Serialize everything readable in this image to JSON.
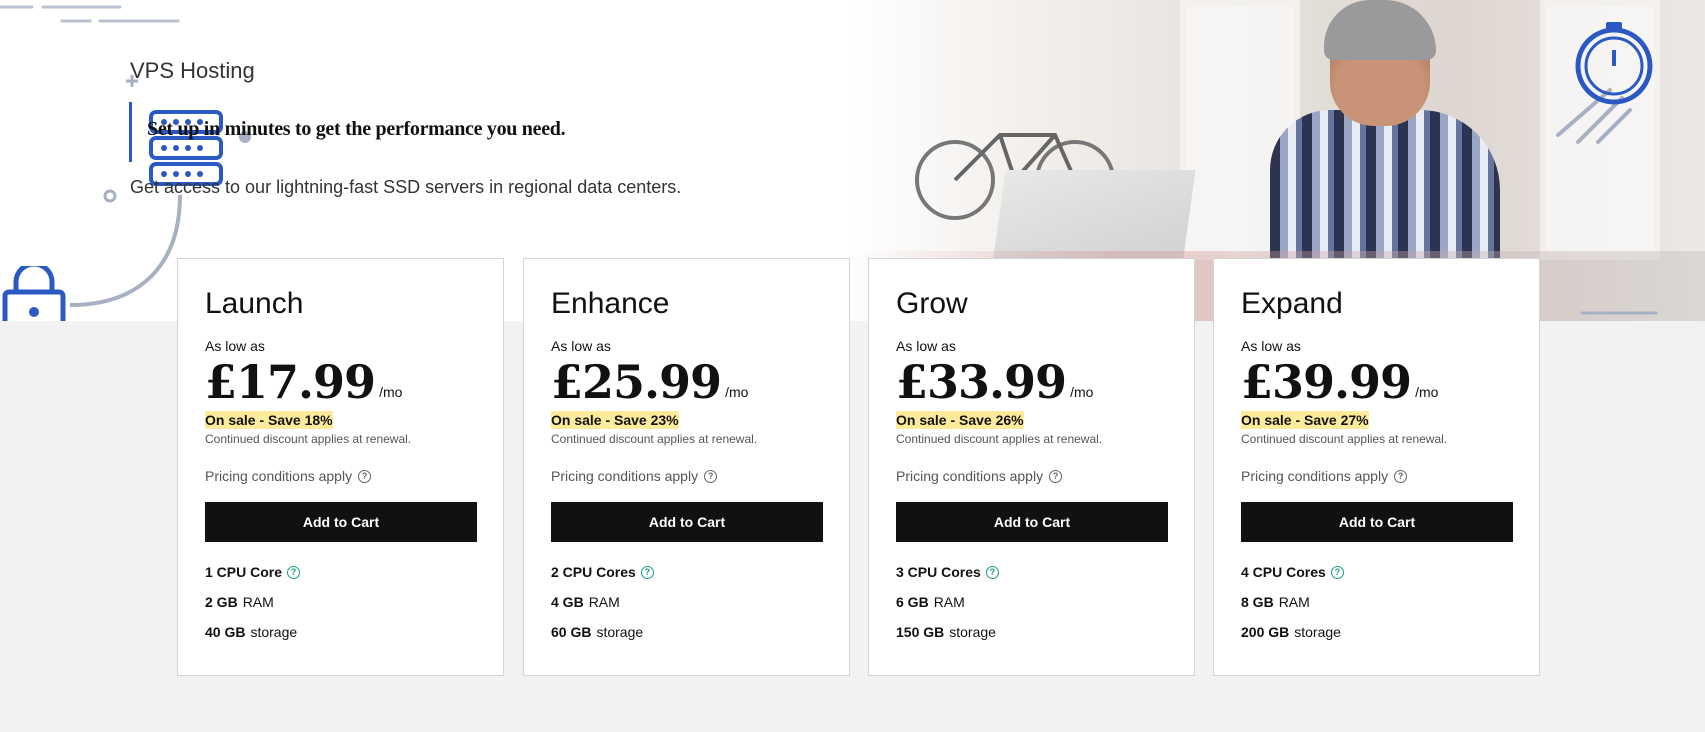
{
  "hero": {
    "title": "VPS Hosting",
    "tagline": "Set up in minutes to get the performance you need.",
    "subtitle": "Get access to our lightning-fast SSD servers in regional data centers.",
    "accent_color": "#2b59c3"
  },
  "plans": [
    {
      "name": "Launch",
      "as_low_as": "As low as",
      "price": "£17.99",
      "per": "/mo",
      "sale": "On sale - Save 18%",
      "renewal": "Continued discount applies at renewal.",
      "conditions": "Pricing conditions apply",
      "cta": "Add to Cart",
      "cpu_value": "1 CPU Core",
      "ram_value": "2 GB",
      "ram_unit": "RAM",
      "storage_value": "40 GB",
      "storage_unit": "storage"
    },
    {
      "name": "Enhance",
      "as_low_as": "As low as",
      "price": "£25.99",
      "per": "/mo",
      "sale": "On sale - Save 23%",
      "renewal": "Continued discount applies at renewal.",
      "conditions": "Pricing conditions apply",
      "cta": "Add to Cart",
      "cpu_value": "2 CPU Cores",
      "ram_value": "4 GB",
      "ram_unit": "RAM",
      "storage_value": "60 GB",
      "storage_unit": "storage"
    },
    {
      "name": "Grow",
      "as_low_as": "As low as",
      "price": "£33.99",
      "per": "/mo",
      "sale": "On sale - Save 26%",
      "renewal": "Continued discount applies at renewal.",
      "conditions": "Pricing conditions apply",
      "cta": "Add to Cart",
      "cpu_value": "3 CPU Cores",
      "ram_value": "6 GB",
      "ram_unit": "RAM",
      "storage_value": "150 GB",
      "storage_unit": "storage"
    },
    {
      "name": "Expand",
      "as_low_as": "As low as",
      "price": "£39.99",
      "per": "/mo",
      "sale": "On sale - Save 27%",
      "renewal": "Continued discount applies at renewal.",
      "conditions": "Pricing conditions apply",
      "cta": "Add to Cart",
      "cpu_value": "4 CPU Cores",
      "ram_value": "8 GB",
      "ram_unit": "RAM",
      "storage_value": "200 GB",
      "storage_unit": "storage"
    }
  ],
  "colors": {
    "sale_highlight": "#fdeb9b",
    "button_bg": "#111111",
    "help_icon": "#1a9c8f",
    "page_bg": "#f2f2f2"
  },
  "icons": [
    "help-icon",
    "server-icon",
    "lock-icon",
    "stopwatch-icon"
  ]
}
